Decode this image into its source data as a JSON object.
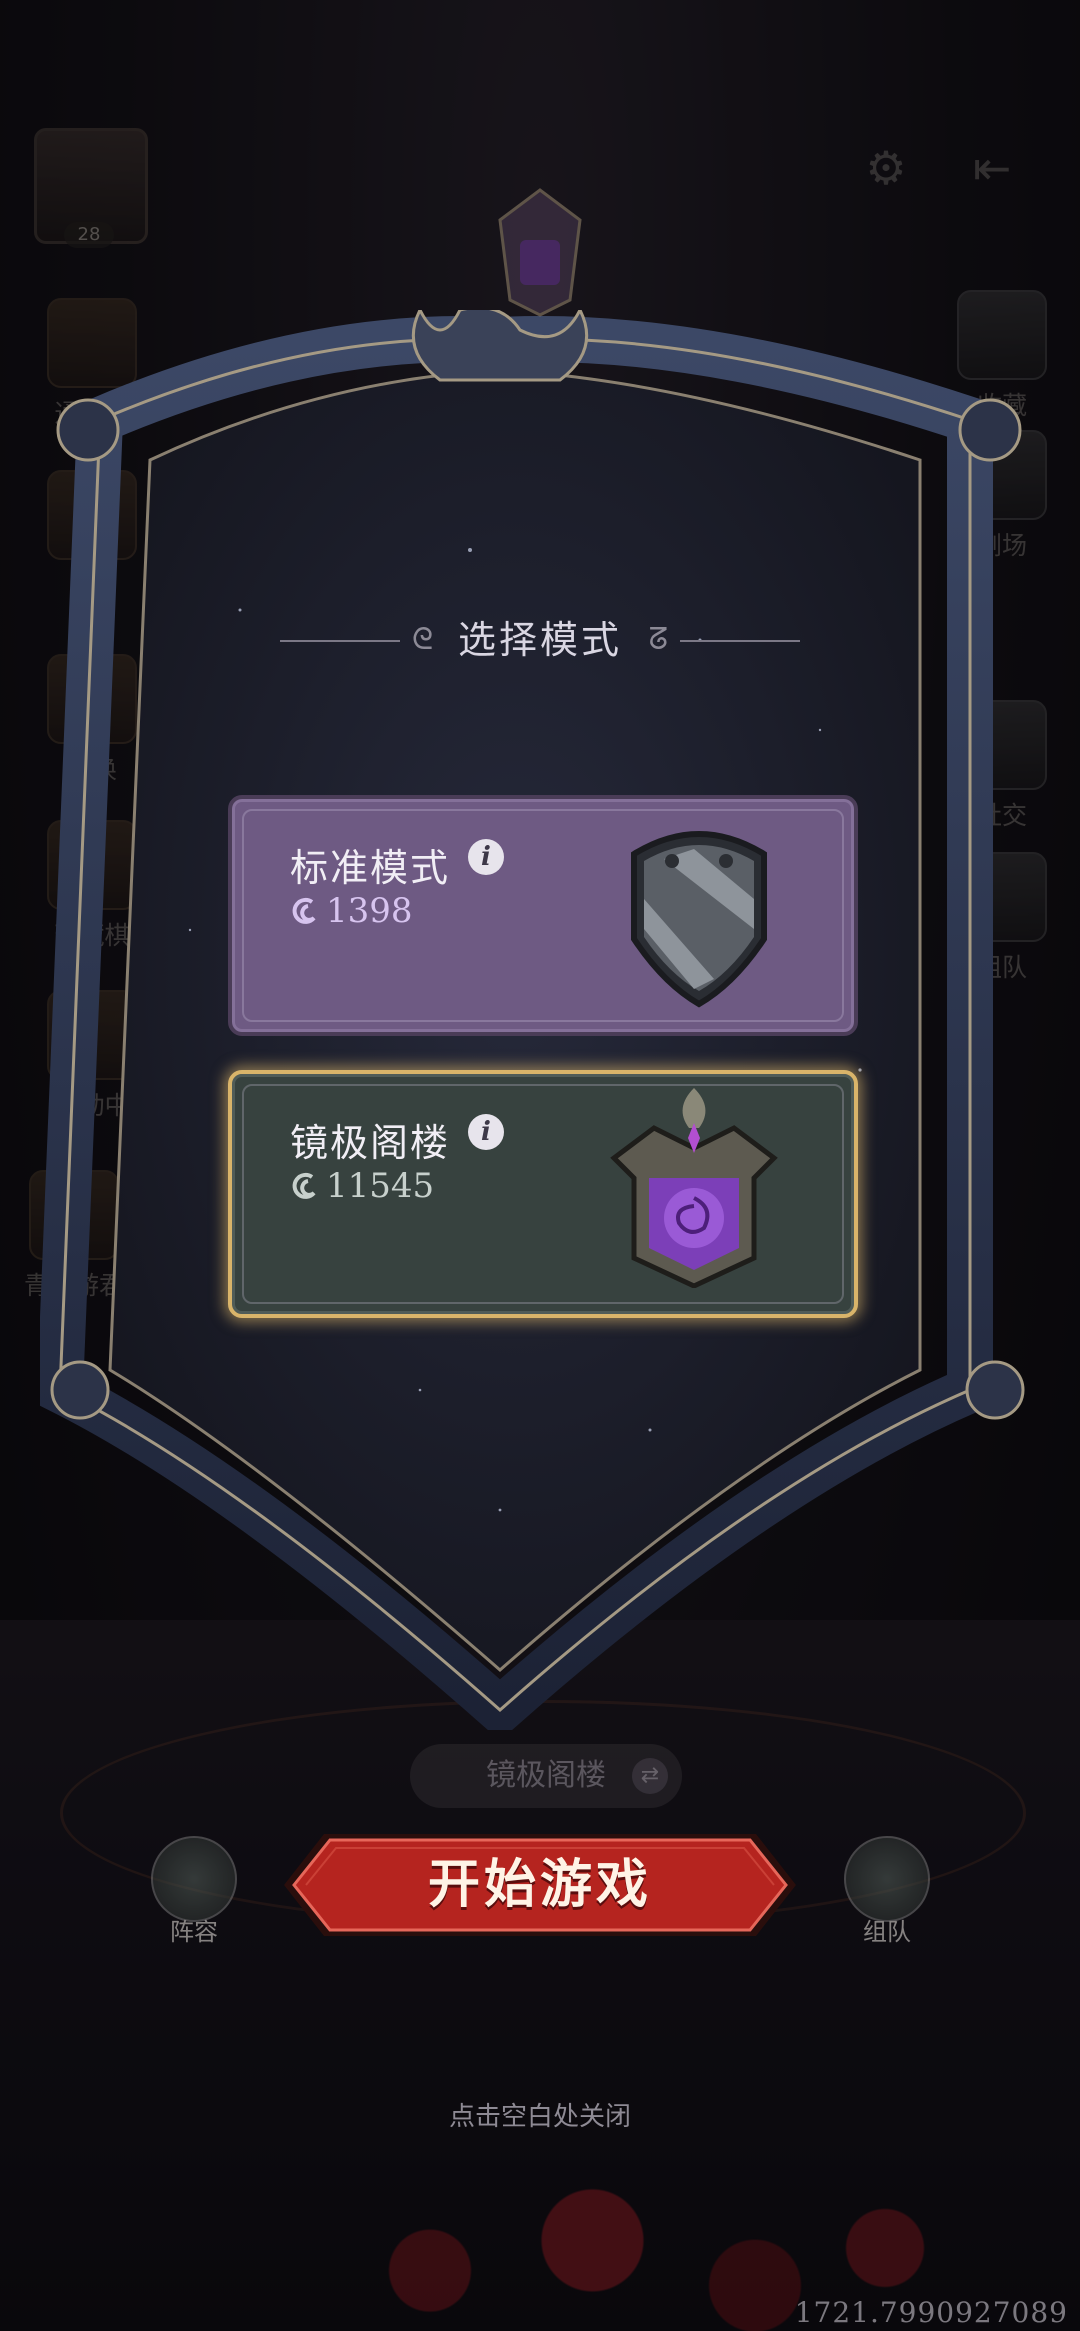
{
  "top_bar": {
    "avatar_level": "28",
    "settings_icon": "gear-icon",
    "exit_icon": "exit-icon"
  },
  "left_menu": [
    {
      "label": "通行证",
      "icon": "pass-card-icon"
    },
    {
      "label": "",
      "icon": "shop-icon"
    },
    {
      "label": "召唤",
      "icon": "summon-icon"
    },
    {
      "label": "珍藏棋",
      "icon": "treasure-icon"
    },
    {
      "label": "活动中",
      "icon": "event-icon"
    },
    {
      "label": "青蛇游君",
      "icon": "hero-icon"
    }
  ],
  "right_menu": [
    {
      "label": "收藏",
      "icon": "collection-icon"
    },
    {
      "label": "剧场",
      "icon": "theater-icon"
    },
    {
      "label": "社交",
      "icon": "social-icon"
    },
    {
      "label": "组队",
      "icon": "team-icon"
    }
  ],
  "dialog": {
    "title": "选择模式",
    "modes": [
      {
        "name": "标准模式",
        "score": "1398",
        "info_icon": "i",
        "emblem": "silver-shield-emblem",
        "selected": false,
        "color": "#6e5a83"
      },
      {
        "name": "镜极阁楼",
        "score": "11545",
        "info_icon": "i",
        "emblem": "purple-rose-crown-emblem",
        "selected": true,
        "color": "#37423f"
      }
    ]
  },
  "bottom": {
    "current_mode": "镜极阁楼",
    "start_button": "开始游戏",
    "lineup_label": "阵容",
    "team_label": "组队",
    "close_hint": "点击空白处关闭"
  },
  "watermark": "1721.7990927089",
  "colors": {
    "accent_gold": "#d9b46a",
    "start_red": "#b5241f"
  }
}
